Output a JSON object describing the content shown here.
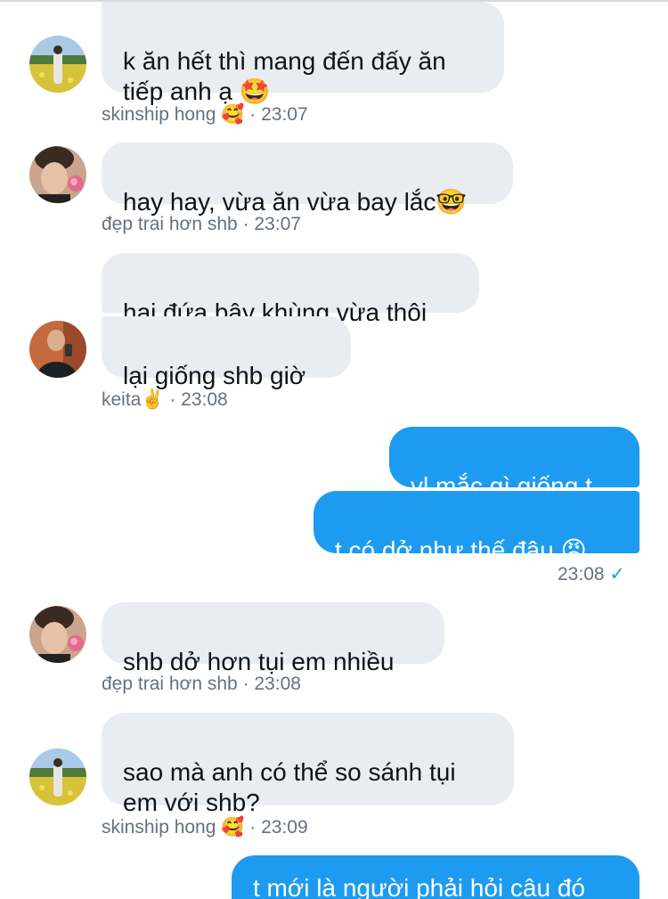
{
  "messages": [
    {
      "sender": "skinship hong",
      "text": "k ăn hết thì mang đến đấy ăn\ntiếp anh ạ",
      "emoji": "🤩",
      "avatar_icon": "field-photo-avatar"
    },
    {
      "sender": "đẹp trai hơn shb",
      "text": "hay hay, vừa ăn vừa bay lắc",
      "emoji": "🤓",
      "avatar_icon": "selfie-flower-avatar"
    },
    {
      "sender": "keita",
      "text": "hai đứa bây khùng vừa thôi",
      "avatar_icon": "mirror-selfie-avatar"
    },
    {
      "sender": "keita",
      "text": "lại giống shb giờ"
    },
    {
      "sender": "me",
      "text": "vl mắc gì giống t"
    },
    {
      "sender": "me",
      "text": "t có dở như thế đâu",
      "emoji": "😡"
    },
    {
      "sender": "đẹp trai hơn shb",
      "text": "shb dở hơn tụi em nhiều"
    },
    {
      "sender": "skinship hong",
      "text": "sao mà anh có thể so sánh tụi\nem với shb?"
    },
    {
      "sender": "me",
      "text": "t mới là người phải hỏi câu đó"
    }
  ],
  "metas": [
    {
      "name": "skinship hong",
      "emoji": "🥰",
      "time": "· 23:07"
    },
    {
      "name": "đẹp trai hơn shb",
      "time": "· 23:07"
    },
    {
      "name": "keita",
      "emoji": "✌️",
      "time": "· 23:08"
    },
    {
      "time": "23:08",
      "status_icon": "✓"
    },
    {
      "name": "đẹp trai hơn shb",
      "time": "· 23:08"
    },
    {
      "name": "skinship hong",
      "emoji": "🥰",
      "time": "· 23:09"
    }
  ],
  "colors": {
    "incoming_bubble": "#e9ecf0",
    "outgoing_bubble": "#1d9bf0",
    "meta_text": "#66717c"
  }
}
